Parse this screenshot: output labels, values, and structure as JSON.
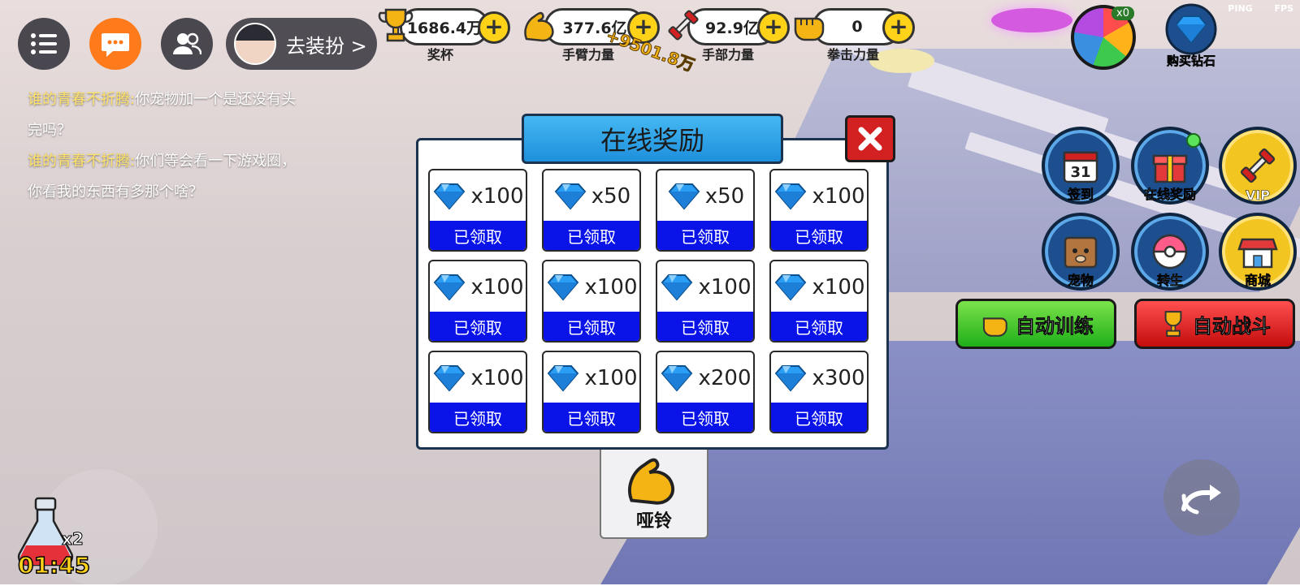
{
  "top_left": {
    "dressup_label": "去装扮 >"
  },
  "currencies": [
    {
      "value": "1686.4万",
      "label": "奖杯",
      "icon": "trophy-icon"
    },
    {
      "value": "377.6亿",
      "label": "手臂力量",
      "icon": "bicep-icon"
    },
    {
      "value": "92.9亿",
      "label": "手部力量",
      "icon": "dumbbell-icon"
    },
    {
      "value": "0",
      "label": "拳击力量",
      "icon": "fist-icon"
    }
  ],
  "floating_gain": "+9501.8万",
  "status": {
    "ping_label": "PING",
    "fps_label": "FPS",
    "diamond_count": "x0"
  },
  "buy_diamond_label": "购买钻石",
  "chat": [
    {
      "name": "谁的青春不折腾:",
      "text": "你宠物加一个是还没有头"
    },
    {
      "name": "",
      "text": "完吗？"
    },
    {
      "name": "谁的青春不折腾:",
      "text": "你们等会看一下游戏圈，"
    },
    {
      "name": "",
      "text": "你看我的东西有多那个啥？"
    }
  ],
  "side_buttons": [
    {
      "label": "签到",
      "icon": "calendar-icon",
      "calendar_day": "31"
    },
    {
      "label": "在线奖励",
      "icon": "gift-icon"
    },
    {
      "label": "VIP",
      "icon": "vip-dumbbell-icon"
    },
    {
      "label": "宠物",
      "icon": "pet-icon"
    },
    {
      "label": "转生",
      "icon": "rebirth-icon"
    },
    {
      "label": "商城",
      "icon": "shop-icon"
    }
  ],
  "auto_train_label": "自动训练",
  "auto_fight_label": "自动战斗",
  "modal": {
    "title": "在线奖励",
    "rewards": [
      {
        "amount": "x100",
        "status": "已领取"
      },
      {
        "amount": "x50",
        "status": "已领取"
      },
      {
        "amount": "x50",
        "status": "已领取"
      },
      {
        "amount": "x100",
        "status": "已领取"
      },
      {
        "amount": "x100",
        "status": "已领取"
      },
      {
        "amount": "x100",
        "status": "已领取"
      },
      {
        "amount": "x100",
        "status": "已领取"
      },
      {
        "amount": "x100",
        "status": "已领取"
      },
      {
        "amount": "x100",
        "status": "已领取"
      },
      {
        "amount": "x100",
        "status": "已领取"
      },
      {
        "amount": "x200",
        "status": "已领取"
      },
      {
        "amount": "x300",
        "status": "已领取"
      }
    ]
  },
  "dumbbell_card_label": "哑铃",
  "potion": {
    "multiplier": "x2",
    "timer": "01:45"
  },
  "colors": {
    "status_blue": "#0b14e8",
    "title_blue": "#1e8fdc",
    "close_red": "#d32121",
    "gold": "#ffd21a"
  }
}
